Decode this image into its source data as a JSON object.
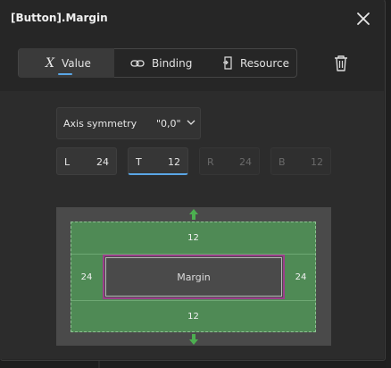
{
  "popup": {
    "title": "[Button].Margin"
  },
  "tabs": [
    {
      "label": "Value",
      "icon": "x-variable-icon",
      "active": true
    },
    {
      "label": "Binding",
      "icon": "link-icon",
      "active": false
    },
    {
      "label": "Resource",
      "icon": "resource-icon",
      "active": false
    }
  ],
  "axis_symmetry": {
    "label": "Axis symmetry",
    "value": "\"0,0\""
  },
  "fields": {
    "left": {
      "label": "L",
      "value": "24"
    },
    "top": {
      "label": "T",
      "value": "12"
    },
    "right": {
      "label": "R",
      "value": "24"
    },
    "bottom": {
      "label": "B",
      "value": "12"
    }
  },
  "diagram": {
    "top": "12",
    "bottom": "12",
    "left": "24",
    "right": "24",
    "center": "Margin"
  },
  "colors": {
    "accent": "#5aa6e6",
    "margin_green": "#4f8a55",
    "arrow_green": "#4caf50",
    "element_border": "#9b3f8b"
  }
}
